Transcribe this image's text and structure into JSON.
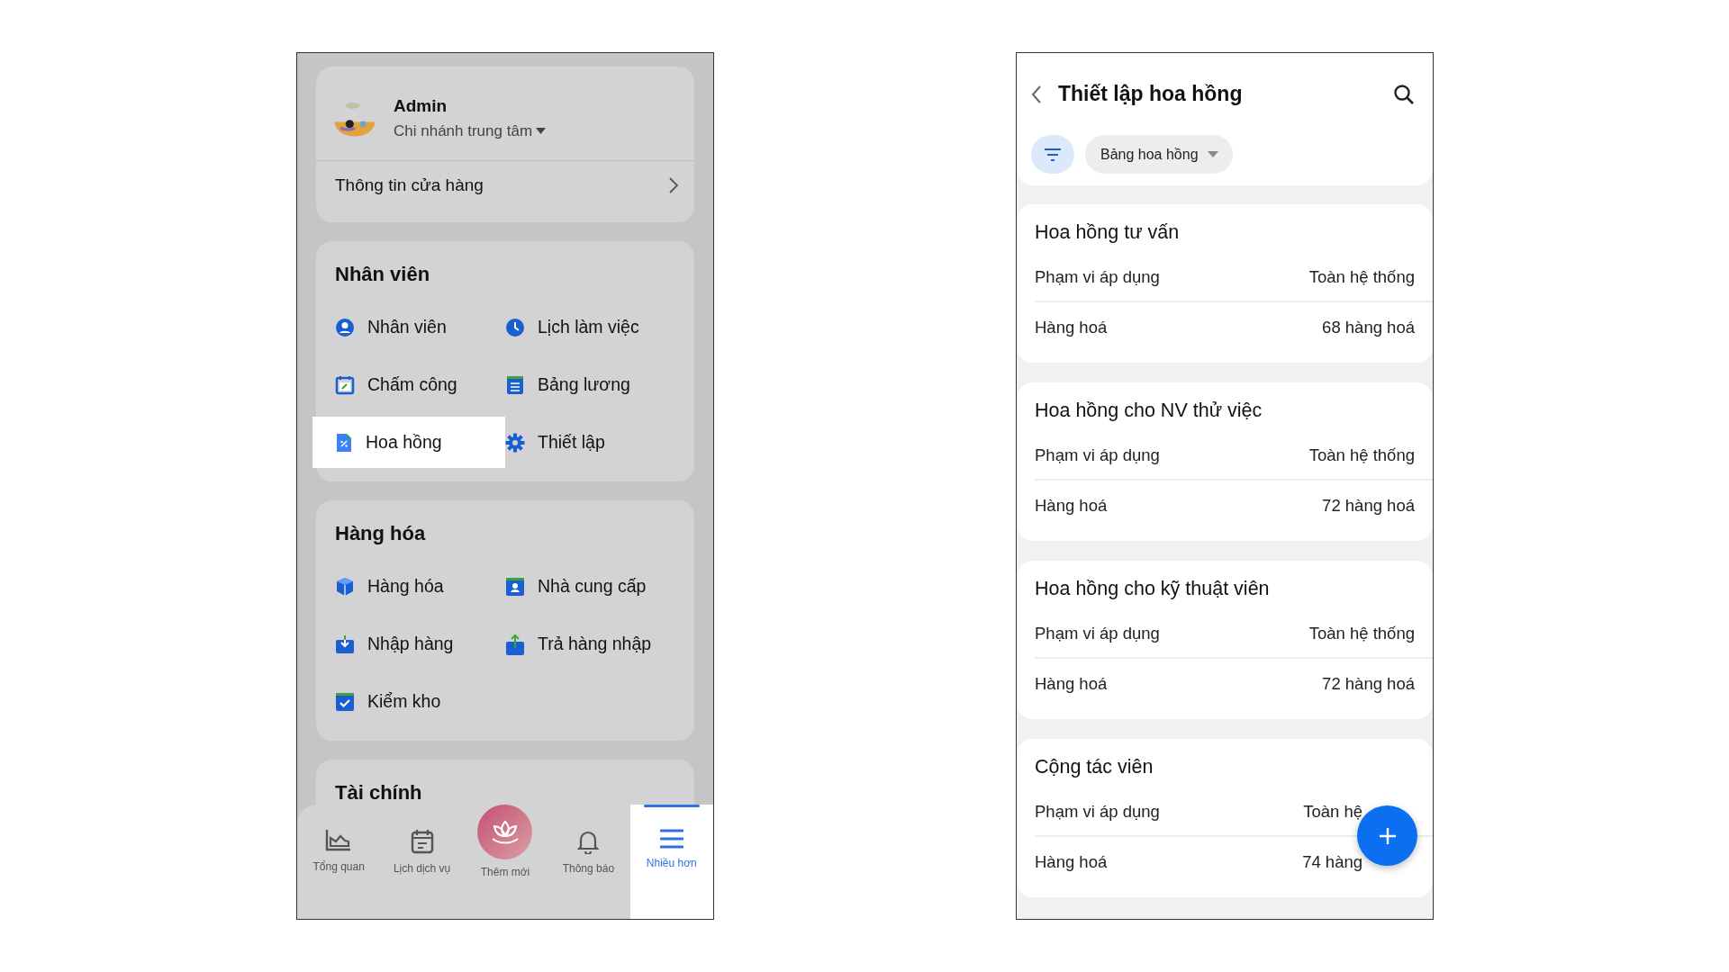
{
  "left_screen": {
    "profile": {
      "name": "Admin",
      "branch": "Chi nhánh trung tâm"
    },
    "store_info": "Thông tin cửa hàng",
    "sections": [
      {
        "title": "Nhân viên",
        "items": [
          {
            "label": "Nhân viên",
            "selected": false
          },
          {
            "label": "Lịch làm việc",
            "selected": false
          },
          {
            "label": "Chấm công",
            "selected": false
          },
          {
            "label": "Bảng lương",
            "selected": false
          },
          {
            "label": "Hoa hồng",
            "selected": true
          },
          {
            "label": "Thiết lập",
            "selected": false
          }
        ]
      },
      {
        "title": "Hàng hóa",
        "items": [
          {
            "label": "Hàng hóa",
            "selected": false
          },
          {
            "label": "Nhà cung cấp",
            "selected": false
          },
          {
            "label": "Nhập hàng",
            "selected": false
          },
          {
            "label": "Trả hàng nhập",
            "selected": false
          },
          {
            "label": "Kiểm kho",
            "selected": false
          }
        ]
      },
      {
        "title": "Tài chính"
      }
    ],
    "bottom_nav": [
      {
        "label": "Tổng quan",
        "kind": "tab",
        "selected": false
      },
      {
        "label": "Lịch dịch vụ",
        "kind": "tab",
        "selected": false
      },
      {
        "label": "Thêm mới",
        "kind": "center",
        "selected": false
      },
      {
        "label": "Thông báo",
        "kind": "tab",
        "selected": false
      },
      {
        "label": "Nhiều hơn",
        "kind": "tab",
        "selected": true
      }
    ]
  },
  "right_screen": {
    "title": "Thiết lập hoa hồng",
    "filter_chip": "Bảng hoa hồng",
    "cards": [
      {
        "title": "Hoa hồng tư vấn",
        "rows": [
          {
            "label": "Phạm vi áp dụng",
            "value": "Toàn hệ thống"
          },
          {
            "label": "Hàng hoá",
            "value": "68 hàng hoá"
          }
        ]
      },
      {
        "title": "Hoa hồng cho NV thử việc",
        "rows": [
          {
            "label": "Phạm vi áp dụng",
            "value": "Toàn hệ thống"
          },
          {
            "label": "Hàng hoá",
            "value": "72 hàng hoá"
          }
        ]
      },
      {
        "title": "Hoa hồng cho kỹ thuật viên",
        "rows": [
          {
            "label": "Phạm vi áp dụng",
            "value": "Toàn hệ thống"
          },
          {
            "label": "Hàng hoá",
            "value": "72 hàng hoá"
          }
        ]
      },
      {
        "title": "Cộng tác viên",
        "rows": [
          {
            "label": "Phạm vi áp dụng",
            "value": "Toàn hệ",
            "covered": true
          },
          {
            "label": "Hàng hoá",
            "value": "74 hàng",
            "covered": true
          }
        ]
      }
    ]
  }
}
